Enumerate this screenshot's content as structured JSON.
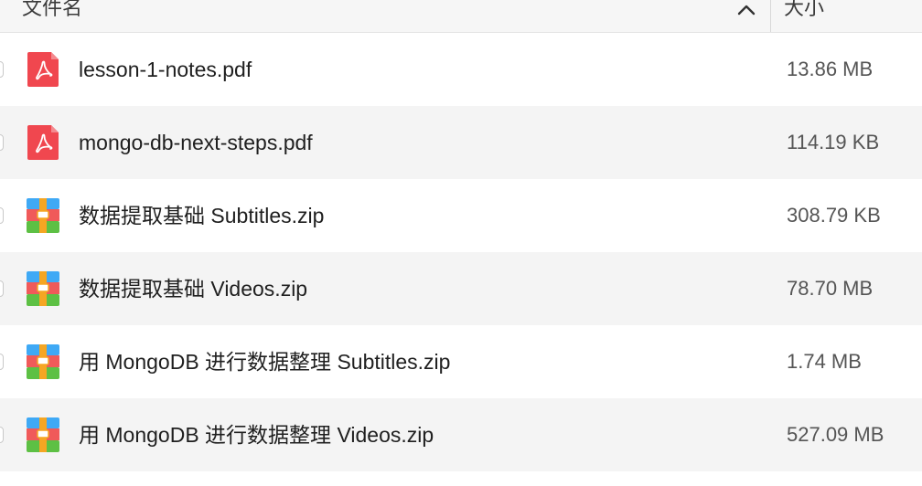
{
  "header": {
    "name_label": "文件名",
    "size_label": "大小",
    "sort_icon": "chevron-up-icon"
  },
  "files": [
    {
      "name": "lesson-1-notes.pdf",
      "size": "13.86 MB",
      "icon": "pdf-file-icon"
    },
    {
      "name": "mongo-db-next-steps.pdf",
      "size": "114.19 KB",
      "icon": "pdf-file-icon"
    },
    {
      "name": "数据提取基础 Subtitles.zip",
      "size": "308.79 KB",
      "icon": "zip-archive-icon"
    },
    {
      "name": "数据提取基础 Videos.zip",
      "size": "78.70 MB",
      "icon": "zip-archive-icon"
    },
    {
      "name": "用 MongoDB 进行数据整理 Subtitles.zip",
      "size": "1.74 MB",
      "icon": "zip-archive-icon"
    },
    {
      "name": "用 MongoDB 进行数据整理 Videos.zip",
      "size": "527.09 MB",
      "icon": "zip-archive-icon"
    }
  ],
  "colors": {
    "pdf_red": "#f0474f",
    "zip_blue": "#3fa9f5",
    "zip_red": "#f05a5a",
    "zip_green": "#5dc044",
    "zip_orange": "#f5a623"
  }
}
